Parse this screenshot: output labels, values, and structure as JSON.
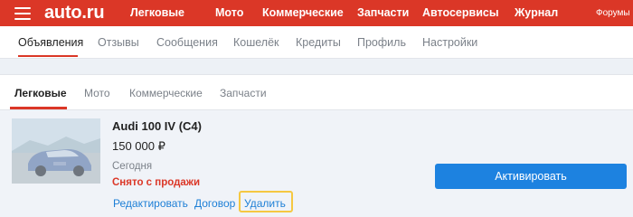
{
  "topbar": {
    "logo": "auto.ru",
    "nav": [
      "Легковые",
      "Мото",
      "Коммерческие",
      "Запчасти",
      "Автосервисы",
      "Журнал"
    ],
    "forums": "Форумы",
    "color": "#db3727"
  },
  "subnav": {
    "items": [
      "Объявления",
      "Отзывы",
      "Сообщения",
      "Кошелёк",
      "Кредиты",
      "Профиль",
      "Настройки"
    ],
    "active": "Объявления"
  },
  "categories": {
    "items": [
      "Легковые",
      "Мото",
      "Коммерческие",
      "Запчасти"
    ],
    "active": "Легковые"
  },
  "listing": {
    "title": "Audi 100 IV (C4)",
    "price": "150 000 ₽",
    "date": "Сегодня",
    "status": "Снято с продажи",
    "actions": {
      "edit": "Редактировать",
      "contract": "Договор",
      "delete": "Удалить"
    },
    "activate_label": "Активировать",
    "accent": "#1d82e0",
    "status_color": "#db3727",
    "highlight_color": "#f5c842"
  }
}
